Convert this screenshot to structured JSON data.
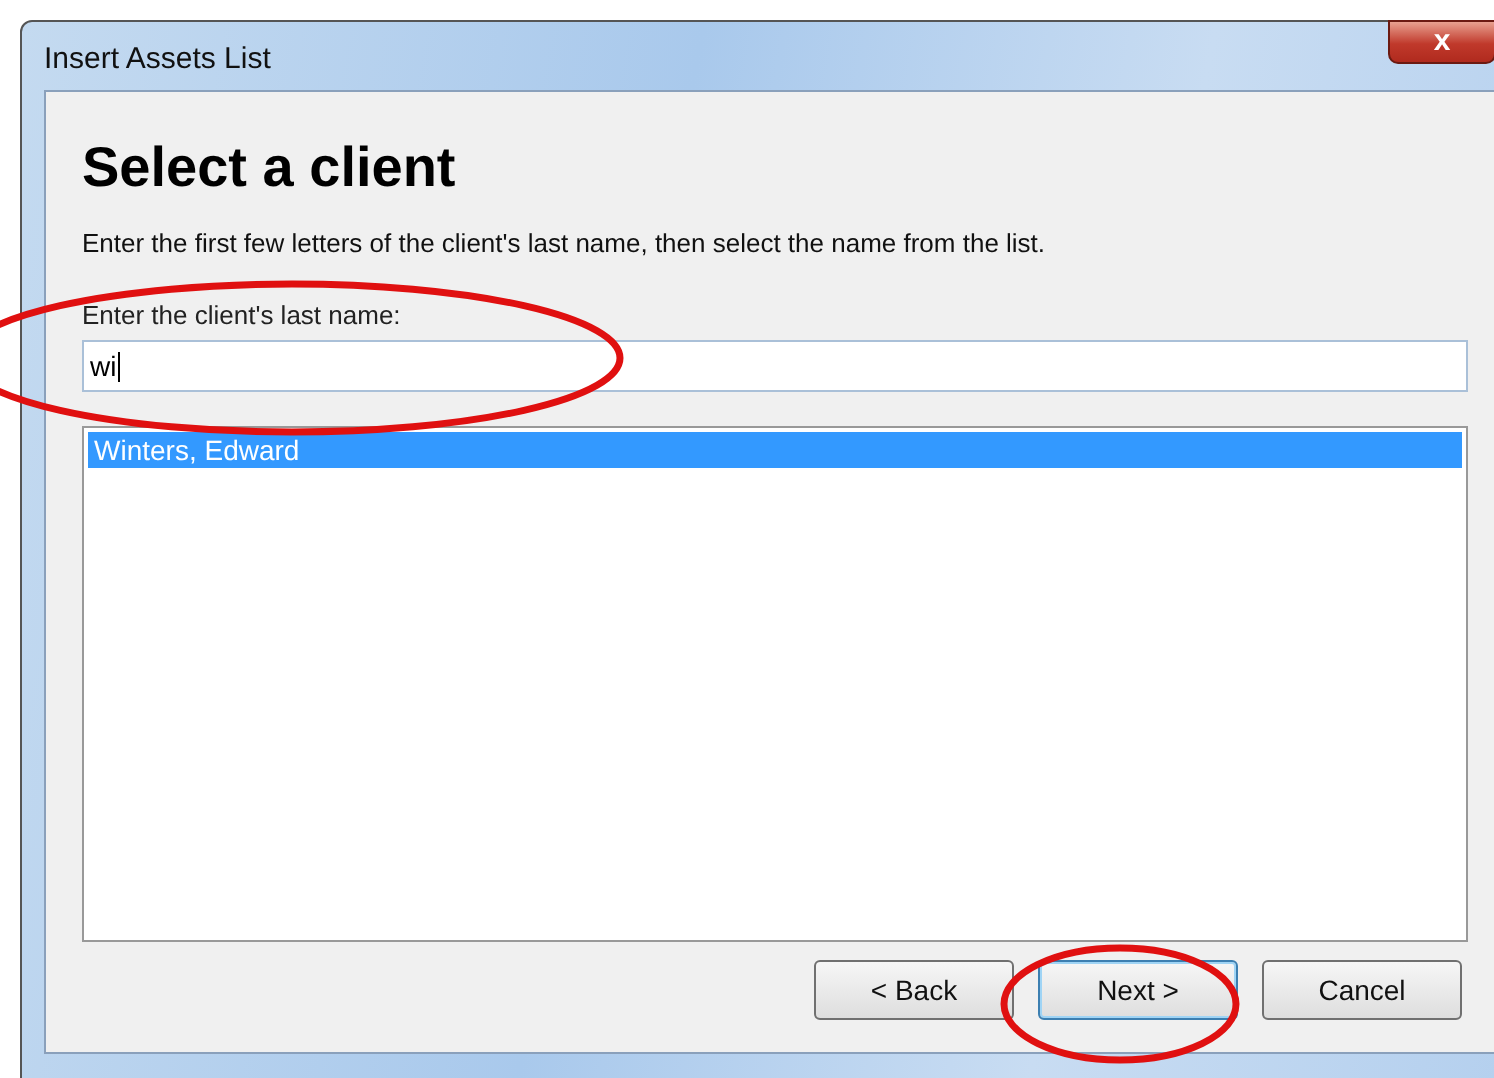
{
  "window": {
    "title": "Insert Assets List",
    "close": "x"
  },
  "heading": "Select a client",
  "instruction": "Enter the first few letters of the client's last name, then select the name from the list.",
  "name_field": {
    "label": "Enter the client's last name:",
    "value": "wi"
  },
  "client_list": [
    {
      "name": "Winters, Edward",
      "selected": true
    }
  ],
  "buttons": [
    {
      "label": "< Back",
      "default": false
    },
    {
      "label": "Next >",
      "default": true
    },
    {
      "label": "Cancel",
      "default": false
    }
  ],
  "annotations": [
    {
      "kind": "ellipse"
    },
    {
      "kind": "ellipse"
    }
  ]
}
